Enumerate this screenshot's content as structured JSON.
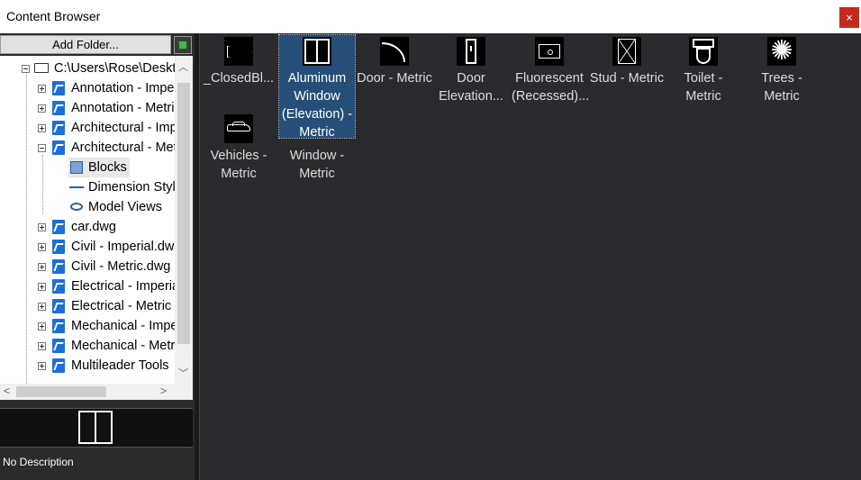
{
  "window": {
    "title": "Content Browser",
    "close_label": "×"
  },
  "toolbar": {
    "add_folder_label": "Add Folder..."
  },
  "tree": {
    "root": "C:\\Users\\Rose\\Desktop",
    "items": [
      {
        "label": "Annotation - Imperial"
      },
      {
        "label": "Annotation - Metric"
      },
      {
        "label": "Architectural - Imperial"
      },
      {
        "label": "Architectural - Metric"
      },
      {
        "label": "Blocks"
      },
      {
        "label": "Dimension Styles"
      },
      {
        "label": "Model Views"
      },
      {
        "label": "car.dwg"
      },
      {
        "label": "Civil - Imperial.dwg"
      },
      {
        "label": "Civil - Metric.dwg"
      },
      {
        "label": "Electrical - Imperial"
      },
      {
        "label": "Electrical - Metric"
      },
      {
        "label": "Mechanical - Imperial"
      },
      {
        "label": "Mechanical - Metric"
      },
      {
        "label": "Multileader Tools"
      }
    ]
  },
  "description": {
    "text": "No Description"
  },
  "blocks": [
    {
      "label": "_ClosedBl...",
      "icon": "closed-arrow-icon"
    },
    {
      "label": "Aluminum Window (Elevation) - Metric",
      "icon": "aluminum-window-icon",
      "selected": true
    },
    {
      "label": "Door - Metric",
      "icon": "door-swing-icon"
    },
    {
      "label": "Door Elevation...",
      "icon": "door-elevation-icon"
    },
    {
      "label": "Fluorescent (Recessed)...",
      "icon": "fluorescent-light-icon"
    },
    {
      "label": "Stud - Metric",
      "icon": "stud-icon"
    },
    {
      "label": "Toilet - Metric",
      "icon": "toilet-icon"
    },
    {
      "label": "Trees - Metric",
      "icon": "tree-icon"
    },
    {
      "label": "Vehicles - Metric",
      "icon": "vehicle-icon"
    },
    {
      "label": "Window - Metric",
      "icon": "window-icon"
    }
  ],
  "colors": {
    "close": "#c42b1c",
    "selection": "#264f78",
    "panel": "#292b2e"
  }
}
